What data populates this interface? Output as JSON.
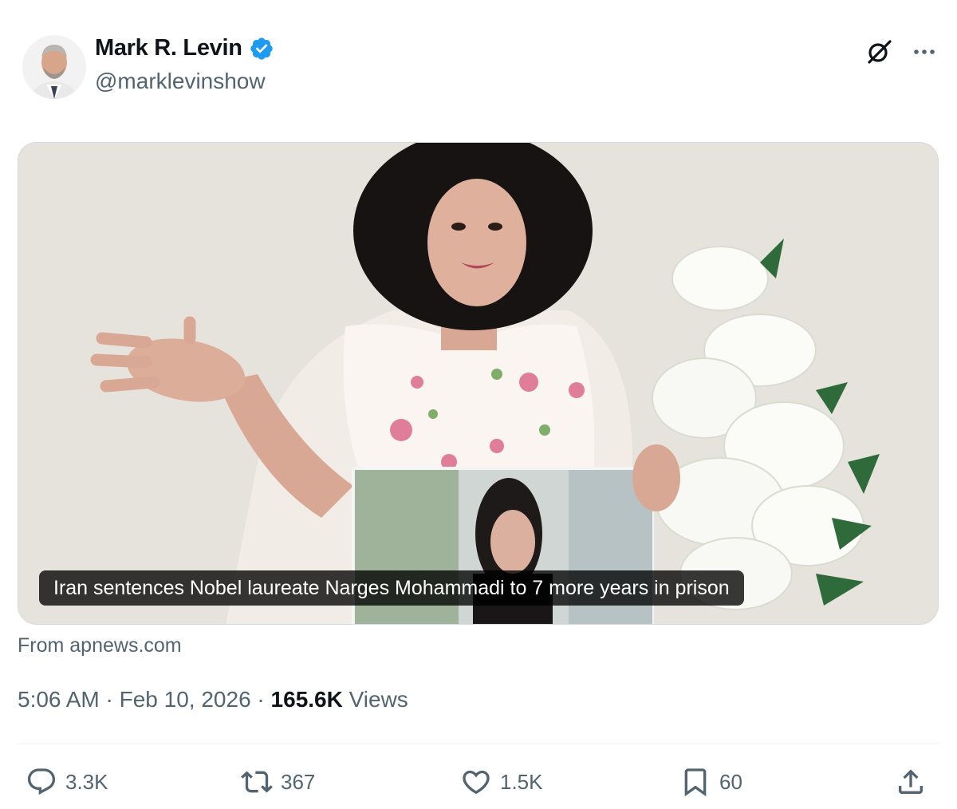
{
  "author": {
    "display_name": "Mark R. Levin",
    "handle": "@marklevinshow",
    "verified": true,
    "avatar_icon": "avatar"
  },
  "header_icons": [
    "grok-icon",
    "more-icon"
  ],
  "media": {
    "caption": "Iran sentences Nobel laureate Narges Mohammadi to 7 more years in prison"
  },
  "source": "From apnews.com",
  "meta": {
    "time": "5:06 AM",
    "separator1": " · ",
    "date": "Feb 10, 2026",
    "separator2": " · ",
    "views_count": "165.6K",
    "views_label": " Views"
  },
  "actions": {
    "replies": "3.3K",
    "reposts": "367",
    "likes": "1.5K",
    "bookmarks": "60"
  },
  "colors": {
    "text": "#0f1419",
    "secondary": "#536471",
    "verified": "#1d9bf0",
    "border": "#cfd9de"
  }
}
